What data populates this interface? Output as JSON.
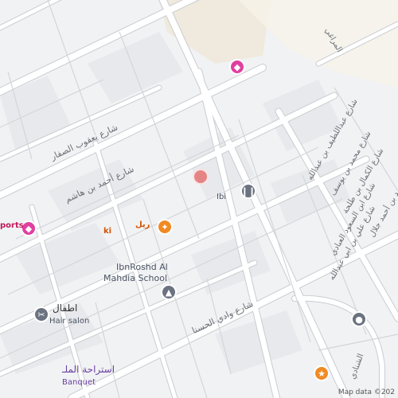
{
  "map": {
    "colors": {
      "background": "#f1f2f4",
      "road": "#ffffff",
      "road_edge": "#c9ccd1",
      "block": "#e9eaed",
      "sand": "#efe6d6",
      "poi_pink": "#e040a0",
      "poi_orange": "#f08a24",
      "poi_gray": "#6b7280"
    },
    "streets": [
      {
        "name": "شارع يعقوب الصفار"
      },
      {
        "name": "شارع أحمد بن هاشم"
      },
      {
        "name": "شارع وادي الحسنا"
      },
      {
        "name": "شارع عبداللطيف بن عبدالله"
      },
      {
        "name": "شارع محمد بن يوسف"
      },
      {
        "name": "شارع الكمال بن طلحة"
      },
      {
        "name": "شارع محمد بن أحمد جلال"
      },
      {
        "name": "شارع ابن السعود العبادي"
      },
      {
        "name": "شارع علي بن ابي عبدالله"
      },
      {
        "name": "المراغي"
      },
      {
        "name": "الشنادي"
      }
    ],
    "pois": [
      {
        "name": "IbnRoshd Al Mahdia School",
        "line1": "IbnRoshd Al",
        "line2": "Mahdia School",
        "icon": "school-icon"
      },
      {
        "name": "اطفال",
        "sub": "Hair salon",
        "icon": "hair-salon-icon"
      },
      {
        "name": "استراحة الملـ",
        "sub": "Banquet",
        "icon": "banquet-icon"
      },
      {
        "name": "ports",
        "icon": "shopping-icon"
      },
      {
        "name": "ريل",
        "icon": "restaurant-icon"
      },
      {
        "name": "ki",
        "icon": ""
      },
      {
        "name": "Ibi",
        "icon": "cafe-icon"
      }
    ],
    "attribution": "Map data ©202"
  }
}
